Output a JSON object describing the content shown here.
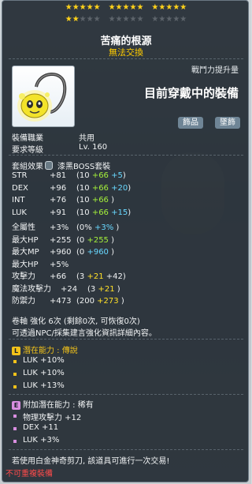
{
  "stars": {
    "row1_filled": 15,
    "row2_filled": 2,
    "row2_total": 15
  },
  "item": {
    "name": "苦痛的根源",
    "trade": "無法交換",
    "power_label": "戰鬥力提升量",
    "power_text": "目前穿戴中的裝備",
    "tags": [
      "飾品",
      "墜飾"
    ],
    "job_label": "裝備職業",
    "job_value": "共用",
    "level_label": "要求等級",
    "level_value": "Lv. 160",
    "set_label": "套組效果",
    "set_value": "漆黑BOSS套裝"
  },
  "stats": [
    {
      "name": "STR",
      "total": "+81",
      "base": "(10",
      "a": "+66",
      "a_color": "#a5f13a",
      "b": "+5",
      "b_color": "#68d8ff",
      "close": ")"
    },
    {
      "name": "DEX",
      "total": "+96",
      "base": "(10",
      "a": "+66",
      "a_color": "#a5f13a",
      "b": "+20",
      "b_color": "#68d8ff",
      "close": ")"
    },
    {
      "name": "INT",
      "total": "+76",
      "base": "(10",
      "a": "+66",
      "a_color": "#a5f13a",
      "b": "",
      "b_color": "#68d8ff",
      "close": ")"
    },
    {
      "name": "LUK",
      "total": "+91",
      "base": "(10",
      "a": "+66",
      "a_color": "#a5f13a",
      "b": "+15",
      "b_color": "#68d8ff",
      "close": ")"
    },
    {
      "name": "全屬性",
      "total": "+3%",
      "base": "(0%",
      "a": "+3%",
      "a_color": "#68d8ff",
      "b": "",
      "b_color": "#68d8ff",
      "close": ")"
    },
    {
      "name": "最大HP",
      "total": "+255",
      "base": "(0",
      "a": "+255",
      "a_color": "#a5f13a",
      "b": "",
      "b_color": "#68d8ff",
      "close": ")"
    },
    {
      "name": "最大MP",
      "total": "+960",
      "base": "(0",
      "a": "+960",
      "a_color": "#68d8ff",
      "b": "",
      "b_color": "#68d8ff",
      "close": ")"
    },
    {
      "name": "最大HP",
      "total": "+5%",
      "base": "",
      "a": "",
      "a_color": "#a5f13a",
      "b": "",
      "b_color": "#68d8ff",
      "close": ""
    },
    {
      "name": "攻擊力",
      "total": "+66",
      "base": "(3",
      "a": "+21",
      "a_color": "#ffe028",
      "b": "+42",
      "b_color": "#f1f3f4",
      "close": ")"
    },
    {
      "name": "魔法攻擊力",
      "total": "+24",
      "base": "(3",
      "a": "+21",
      "a_color": "#ffe028",
      "b": "",
      "b_color": "#68d8ff",
      "close": ")"
    },
    {
      "name": "防禦力",
      "total": "+473",
      "base": "(200",
      "a": "+273",
      "a_color": "#ffe028",
      "b": "",
      "b_color": "#68d8ff",
      "close": ")"
    }
  ],
  "scroll_line": "卷軸 強化 6次 (剩餘0次, 可恢復0次)",
  "npc_line": "可透過NPC/採集建言強化資訊詳細內容。",
  "potential": {
    "title": "潛在能力 : 傳說",
    "badge": "L",
    "badge_color": "#f2c21a",
    "lines": [
      "LUK +10%",
      "LUK +10%",
      "LUK +13%"
    ]
  },
  "additional": {
    "title": "附加潛在能力 : 稀有",
    "badge": "E",
    "badge_color": "#d88ee0",
    "lines": [
      "物理攻擊力 +12",
      "DEX +11",
      "LUK +3%"
    ]
  },
  "footer": {
    "scissors": "若使用白金神奇剪刀, 該道具可進行一次交易!",
    "no_copy": "不可重複裝備"
  },
  "colors": {
    "legend": "#ffcc00",
    "unique": "#68d8ff",
    "red_text": "#ff4b4b"
  }
}
